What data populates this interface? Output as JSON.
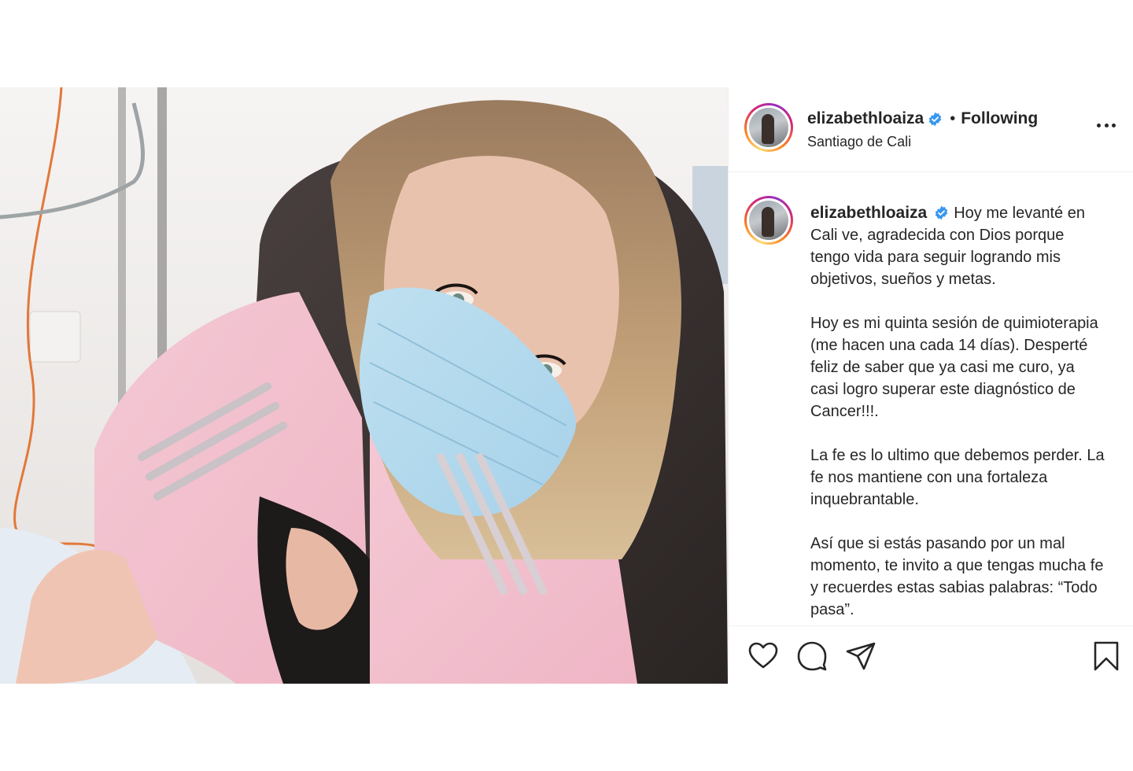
{
  "post": {
    "username": "elizabethloaiza",
    "follow_status": "Following",
    "separator": "•",
    "location": "Santiago de Cali",
    "caption_paragraphs": [
      "Hoy me levanté en Cali ve, agradecida con Dios porque tengo vida para seguir logrando mis objetivos, sueños y metas.",
      "Hoy es mi quinta sesión de quimioterapia (me hacen una cada 14 días). Desperté feliz de saber que ya casi me curo, ya casi logro superar este diagnóstico de Cancer!!!.",
      "La fe es lo ultimo que debemos perder. La fe nos mantiene con una fortaleza inquebrantable.",
      "Así que si estás pasando por un mal momento, te invito a que tengas mucha fe y recuerdes estas sabias palabras: “Todo pasa”."
    ]
  },
  "icons": {
    "verified": "verified-badge-icon",
    "more": "more-options-icon",
    "like": "heart-icon",
    "comment": "comment-icon",
    "share": "paper-plane-icon",
    "save": "bookmark-icon"
  },
  "colors": {
    "verified_blue": "#3897f0",
    "text": "#262626",
    "border": "#efefef"
  }
}
